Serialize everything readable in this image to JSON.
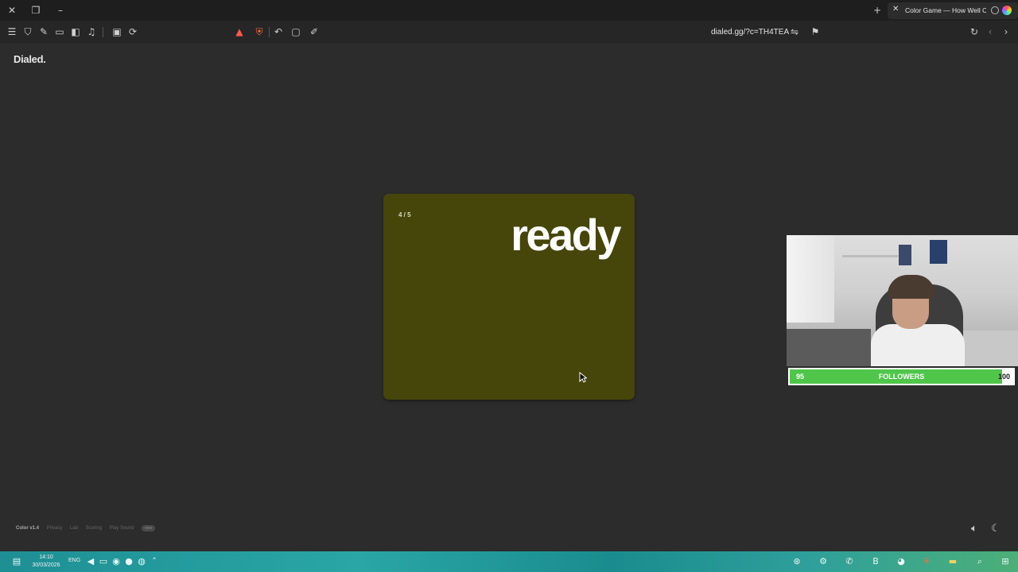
{
  "browser": {
    "tab": {
      "title": "Color Game — How Well Can"
    },
    "address": {
      "url": "dialed.gg/?c=TH4TEA"
    }
  },
  "page": {
    "brand": "Dialed.",
    "card": {
      "progress": "4 / 5",
      "word": "ready",
      "color": "#46460a"
    },
    "footer": {
      "version": "Color v1.4",
      "links": [
        "Privacy",
        "Lab",
        "Scoring",
        "Play Sound"
      ],
      "badge": "new"
    }
  },
  "overlay": {
    "followers": {
      "current": "95",
      "label": "FOLLOWERS",
      "goal": "100",
      "progress": 0.95
    }
  },
  "taskbar": {
    "time": "14:10",
    "date": "30/03/2026",
    "language": "ENG"
  },
  "colors": {
    "background": "#2c2c2c",
    "card": "#46460a",
    "followers_bar": "#4fc64a"
  }
}
